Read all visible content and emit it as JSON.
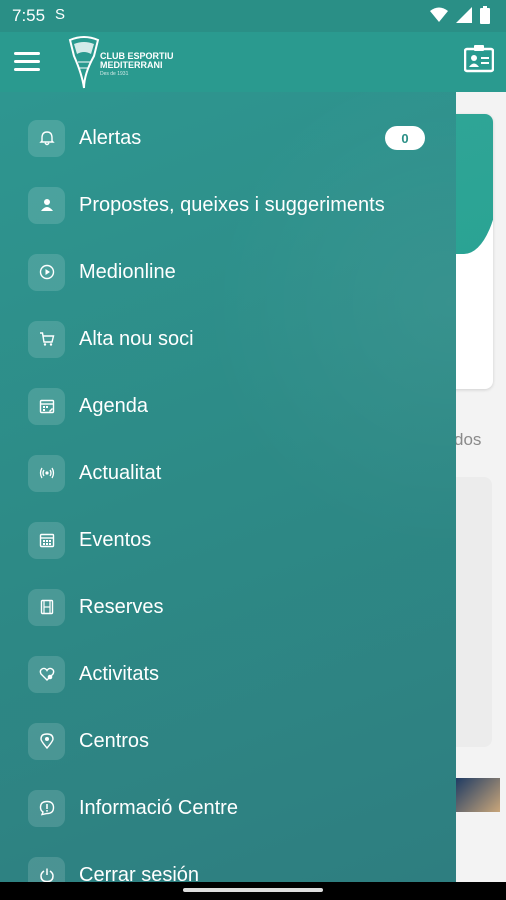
{
  "status_bar": {
    "time": "7:55",
    "carrier_icon": "S"
  },
  "app_bar": {
    "logo_line1": "CLUB ESPORTIU",
    "logo_line2": "MEDITERRANI",
    "logo_line3": "Des de 1931"
  },
  "menu": {
    "items": [
      {
        "label": "Alertas",
        "icon": "bell-icon",
        "badge": "0"
      },
      {
        "label": "Propostes, queixes i suggeriments",
        "icon": "person-icon"
      },
      {
        "label": "Medionline",
        "icon": "play-icon"
      },
      {
        "label": "Alta nou soci",
        "icon": "cart-icon"
      },
      {
        "label": "Agenda",
        "icon": "calendar-edit-icon"
      },
      {
        "label": "Actualitat",
        "icon": "broadcast-icon"
      },
      {
        "label": "Eventos",
        "icon": "calendar-icon"
      },
      {
        "label": "Reserves",
        "icon": "film-icon"
      },
      {
        "label": "Activitats",
        "icon": "heart-icon"
      },
      {
        "label": "Centros",
        "icon": "location-icon"
      },
      {
        "label": "Informació Centre",
        "icon": "info-chat-icon"
      },
      {
        "label": "Cerrar sesión",
        "icon": "power-icon"
      }
    ]
  },
  "background": {
    "fragment_text": "dos"
  }
}
